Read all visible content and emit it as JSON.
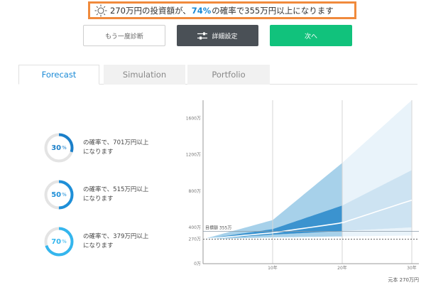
{
  "headline": {
    "prefix": "270万円の投資額が、",
    "probability": "74%",
    "suffix": "の確率で355万円以上になります"
  },
  "buttons": {
    "retry_label": "もう一度診断",
    "detail_label": "詳細設定",
    "next_label": "次へ"
  },
  "tabs": [
    {
      "label": "Forecast",
      "active": true
    },
    {
      "label": "Simulation",
      "active": false
    },
    {
      "label": "Portfolio",
      "active": false
    }
  ],
  "probabilities": [
    {
      "value": "30",
      "unit": "%",
      "line1": "の確率で、701万円以上",
      "line2": "になります",
      "fraction": 0.3,
      "color": "#1a7fc9"
    },
    {
      "value": "50",
      "unit": "%",
      "line1": "の確率で、515万円以上",
      "line2": "になります",
      "fraction": 0.5,
      "color": "#1e8fd8"
    },
    {
      "value": "70",
      "unit": "%",
      "line1": "の確率で、379万円以上",
      "line2": "になります",
      "fraction": 0.7,
      "color": "#34b6ee"
    }
  ],
  "chart_data": {
    "type": "area",
    "x_ticks": [
      {
        "value": 10,
        "label": "10年"
      },
      {
        "value": 20,
        "label": "20年"
      },
      {
        "value": 30,
        "label": "30年"
      }
    ],
    "y_ticks": [
      {
        "value": 0,
        "label": "0万"
      },
      {
        "value": 270,
        "label": "270万"
      },
      {
        "value": 400,
        "label": "400万"
      },
      {
        "value": 800,
        "label": "800万"
      },
      {
        "value": 1200,
        "label": "1200万"
      },
      {
        "value": 1600,
        "label": "1600万"
      }
    ],
    "ylim": [
      0,
      1800
    ],
    "xlim": [
      0,
      30
    ],
    "highlight_until_year": 20,
    "target_line": {
      "value": 355,
      "label": "目標額 355万"
    },
    "principal_line": {
      "value": 270,
      "label": "元本 270万円"
    },
    "bands": {
      "outer": {
        "upper": [
          270,
          480,
          1110,
          1800
        ],
        "lower": [
          270,
          290,
          300,
          310
        ]
      },
      "inner": {
        "upper": [
          270,
          380,
          640,
          1030
        ],
        "lower": [
          270,
          320,
          360,
          400
        ]
      },
      "median": [
        270,
        340,
        450,
        700
      ],
      "x": [
        0,
        10,
        20,
        30
      ]
    },
    "colors": {
      "outer_dark": "#a7d1ea",
      "outer_light": "#e9f3fa",
      "inner_dark": "#3b93cf",
      "inner_light": "#cde3f2",
      "median": "#ffffff"
    }
  }
}
